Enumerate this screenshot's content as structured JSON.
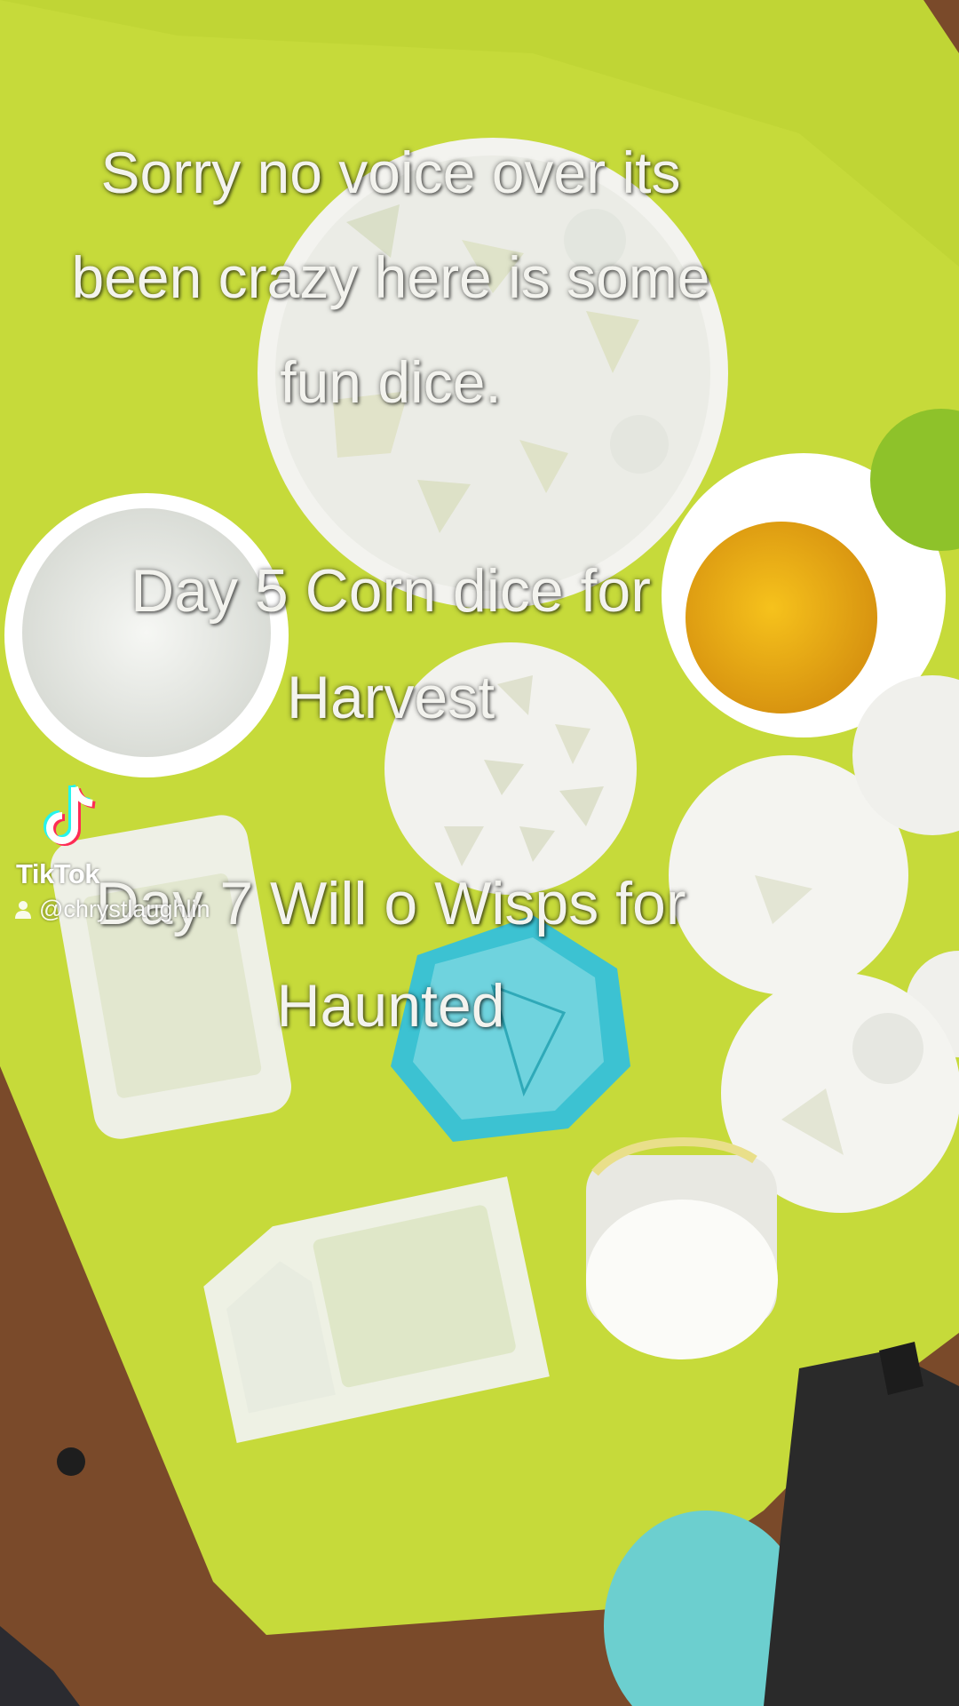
{
  "caption": {
    "lines_1": [
      "Sorry no voice over its",
      "been crazy here is some",
      "fun dice."
    ],
    "lines_2": [
      "Day 5 Corn dice for",
      "Harvest"
    ],
    "lines_3": [
      "Day 7 Will o Wisps for",
      "Haunted"
    ]
  },
  "watermark": {
    "brand": "TikTok",
    "handle": "@chrystlaughlin",
    "icon": "tiktok-logo-icon"
  },
  "colors": {
    "mat": "#c8dc3a",
    "table": "#7a4a2a",
    "mold": "#f2f2ee",
    "teal_mold": "#3cc0d0",
    "resin": "#f0b418"
  }
}
